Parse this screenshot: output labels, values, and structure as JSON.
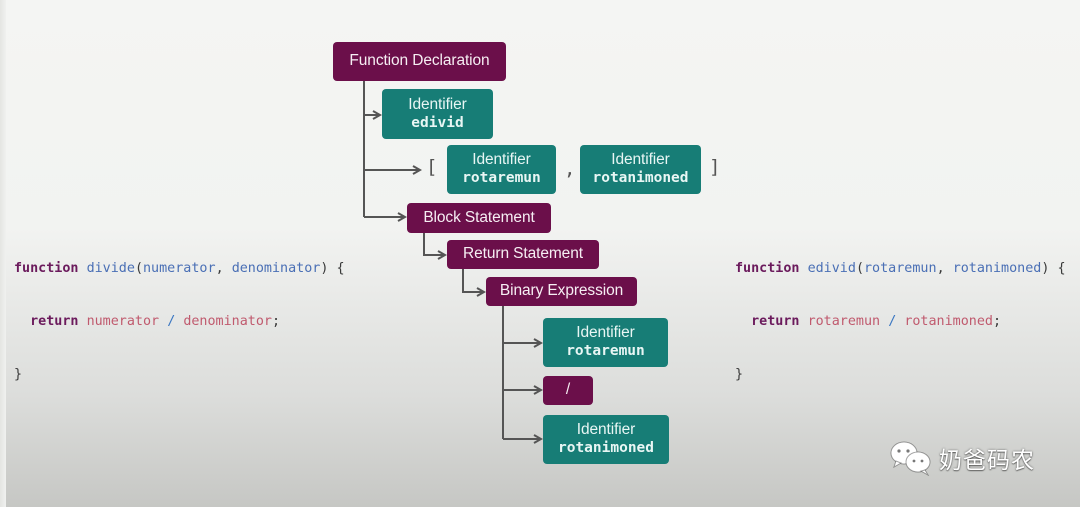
{
  "colors": {
    "statement_node": "#6b0f4a",
    "identifier_node": "#177d76",
    "connector": "#555555",
    "keyword": "#6b1a5c",
    "function_name": "#4a6fb5",
    "reference": "#c05a6e",
    "operator": "#3b77c2"
  },
  "ast": {
    "function_declaration": {
      "label": "Function Declaration"
    },
    "id": {
      "kind": "Identifier",
      "name": "edivid"
    },
    "params": {
      "open_bracket": "[",
      "separator": ",",
      "close_bracket": "]",
      "items": [
        {
          "kind": "Identifier",
          "name": "rotaremun"
        },
        {
          "kind": "Identifier",
          "name": "rotanimoned"
        }
      ]
    },
    "block_statement": {
      "label": "Block Statement"
    },
    "return_statement": {
      "label": "Return Statement"
    },
    "binary_expression": {
      "label": "Binary Expression"
    },
    "left": {
      "kind": "Identifier",
      "name": "rotaremun"
    },
    "operator": {
      "label": "/"
    },
    "right": {
      "kind": "Identifier",
      "name": "rotanimoned"
    }
  },
  "code_original": {
    "line1": {
      "keyword": "function",
      "name": "divide",
      "open": "(",
      "param1": "numerator",
      "comma": ", ",
      "param2": "denominator",
      "close": ") {"
    },
    "line2": {
      "indent": "  ",
      "keyword": "return",
      "left": "numerator",
      "op": "/",
      "right": "denominator",
      "end": ";"
    },
    "line3": {
      "text": "}"
    }
  },
  "code_reversed": {
    "line1": {
      "keyword": "function",
      "name": "edivid",
      "open": "(",
      "param1": "rotaremun",
      "comma": ", ",
      "param2": "rotanimoned",
      "close": ") {"
    },
    "line2": {
      "indent": "  ",
      "keyword": "return",
      "left": "rotaremun",
      "op": "/",
      "right": "rotanimoned",
      "end": ";"
    },
    "line3": {
      "text": "}"
    }
  },
  "watermark": {
    "icon": "wechat-icon",
    "text": "奶爸码农"
  }
}
